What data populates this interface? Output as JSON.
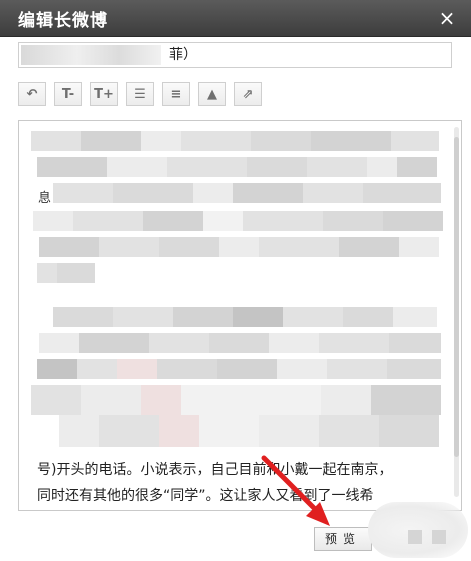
{
  "window": {
    "title": "编辑长微博",
    "close_glyph": "×"
  },
  "title_input": {
    "visible_tail": "菲）"
  },
  "toolbar": {
    "buttons": [
      {
        "name": "undo",
        "glyph": "↶"
      },
      {
        "name": "font-decrease",
        "glyph": "T-"
      },
      {
        "name": "font-increase",
        "glyph": "T+"
      },
      {
        "name": "bullet-list",
        "glyph": "☰"
      },
      {
        "name": "align",
        "glyph": "≡"
      },
      {
        "name": "insert-image",
        "glyph": "▲"
      },
      {
        "name": "share",
        "glyph": "⇗"
      }
    ]
  },
  "editor": {
    "lead_char": "息",
    "line1": "号)开头的电话。小说表示，自己目前和小戴一起在南京，",
    "line2": "同时还有其他的很多“同学”。这让家人又看到了一线希"
  },
  "footer": {
    "preview_label": "预览"
  },
  "colors": {
    "titlebar": "#4a4a4a",
    "annotation_arrow": "#e02020"
  }
}
